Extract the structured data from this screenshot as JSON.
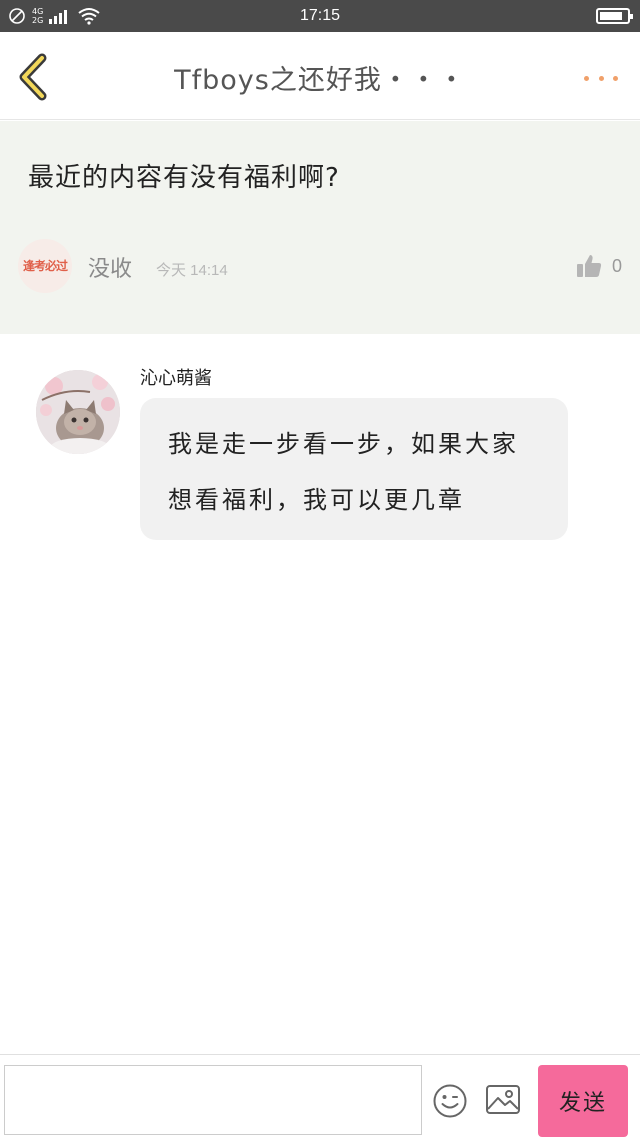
{
  "status_bar": {
    "network_top": "4G",
    "network_bottom": "2G",
    "time": "17:15",
    "battery_level": 0.85
  },
  "header": {
    "title": "Tfboys之还好我・・・",
    "back_icon": "chevron-left-icon",
    "more_icon": "more-dots-icon",
    "accent_color": "#f0a06a"
  },
  "post": {
    "title": "最近的内容有没有福利啊?",
    "avatar_text": "逢考必过",
    "author": "没收",
    "time": "今天 14:14",
    "like_count": "0",
    "background_color": "#f2f4ef"
  },
  "comments": [
    {
      "username": "沁心萌酱",
      "text": "我是走一步看一步，如果大家想看福利，我可以更几章"
    }
  ],
  "compose": {
    "placeholder": "",
    "send_label": "发送",
    "send_color": "#f56a9b",
    "emoji_icon": "smiley-icon",
    "image_icon": "image-icon"
  }
}
